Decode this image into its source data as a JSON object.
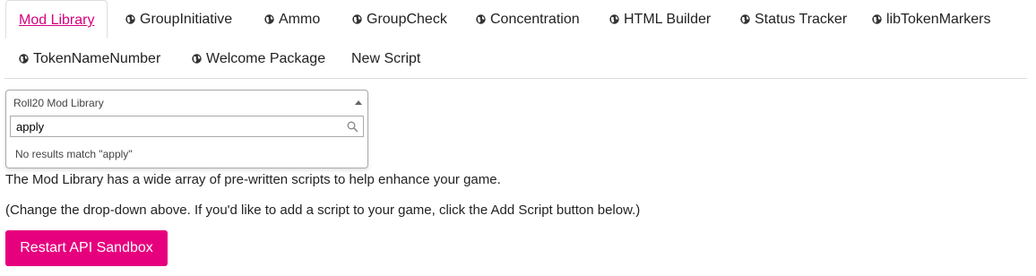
{
  "tabs": {
    "row1": [
      {
        "label": "Mod Library",
        "active": true,
        "icon": null
      },
      {
        "label": "GroupInitiative",
        "icon": "globe-icon"
      },
      {
        "label": "Ammo",
        "icon": "globe-icon"
      },
      {
        "label": "GroupCheck",
        "icon": "globe-icon"
      },
      {
        "label": "Concentration",
        "icon": "globe-icon"
      },
      {
        "label": "HTML Builder",
        "icon": "globe-icon"
      },
      {
        "label": "Status Tracker",
        "icon": "globe-icon"
      },
      {
        "label": "libTokenMarkers",
        "icon": "globe-icon"
      }
    ],
    "row2": [
      {
        "label": "TokenNameNumber",
        "icon": "globe-icon"
      },
      {
        "label": "Welcome Package",
        "icon": "globe-icon"
      },
      {
        "label": "New Script",
        "icon": null
      }
    ]
  },
  "library_select": {
    "selected": "Roll20 Mod Library",
    "search_value": "apply",
    "no_results": "No results match \"apply\""
  },
  "content": {
    "description": "The Mod Library has a wide array of pre-written scripts to help enhance your game.",
    "instruction": "(Change the drop-down above. If you'd like to add a script to your game, click the Add Script button below.)"
  },
  "actions": {
    "restart_label": "Restart API Sandbox"
  },
  "colors": {
    "accent": "#e6007e",
    "active_tab_text": "#d6007e"
  }
}
